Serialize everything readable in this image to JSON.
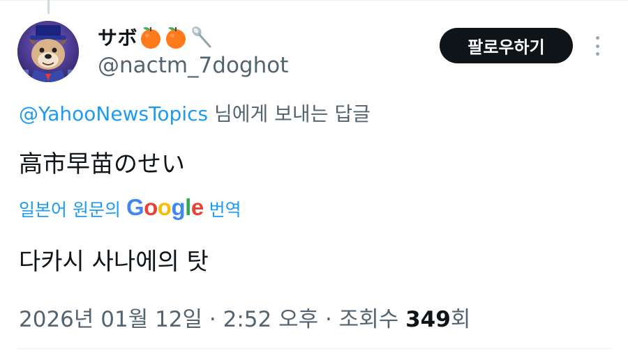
{
  "tweet": {
    "display_name": "サボ",
    "name_emojis": [
      "tangerine-emoji",
      "tangerine-emoji",
      "spoon-emoji"
    ],
    "handle": "@nactm_7doghot",
    "follow_label": "팔로우하기",
    "reply_to_handle": "@YahooNewsTopics",
    "reply_to_suffix": " 님에게 보내는 답글",
    "text": "高市早苗のせい",
    "translate_prefix": "일본어 원문의",
    "translate_brand": "Google",
    "translate_suffix": "번역",
    "translated_text": "다카시 사나에의 탓",
    "timestamp": "2026년 01월 12일 · 2:52 오후 · 조회수 ",
    "views_count": "349",
    "views_suffix": "회"
  },
  "colors": {
    "link": "#1d9bf0",
    "secondary_text": "#536471",
    "primary_text": "#0f1419",
    "follow_button_bg": "#0f1419"
  }
}
